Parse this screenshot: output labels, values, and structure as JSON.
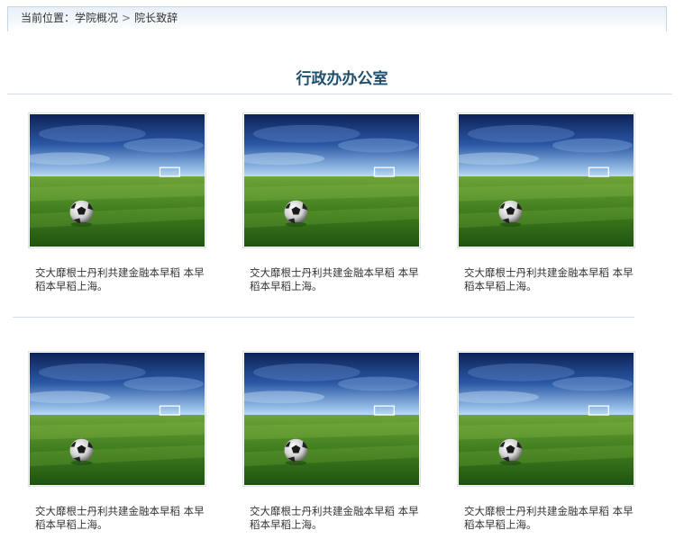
{
  "breadcrumb": {
    "prefix": "当前位置：",
    "crumb1": "学院概况",
    "separator": ">",
    "crumb2": "院长致辞"
  },
  "page_title": "行政办办公室",
  "photos": [
    {
      "caption": "交大靡根士丹利共建金融本早稻 本早稻本早稻上海。",
      "image": "soccer-ball-on-grass-field"
    },
    {
      "caption": "交大靡根士丹利共建金融本早稻 本早稻本早稻上海。",
      "image": "soccer-ball-on-grass-field"
    },
    {
      "caption": "交大靡根士丹利共建金融本早稻 本早稻本早稻上海。",
      "image": "soccer-ball-on-grass-field"
    },
    {
      "caption": "交大靡根士丹利共建金融本早稻 本早稻本早稻上海。",
      "image": "soccer-ball-on-grass-field"
    },
    {
      "caption": "交大靡根士丹利共建金融本早稻 本早稻本早稻上海。",
      "image": "soccer-ball-on-grass-field"
    },
    {
      "caption": "交大靡根士丹利共建金融本早稻 本早稻本早稻上海。",
      "image": "soccer-ball-on-grass-field"
    }
  ],
  "colors": {
    "title": "#1f4f6f",
    "rule": "#cfe0e6",
    "breadcrumb_border": "#c4d7ea"
  }
}
